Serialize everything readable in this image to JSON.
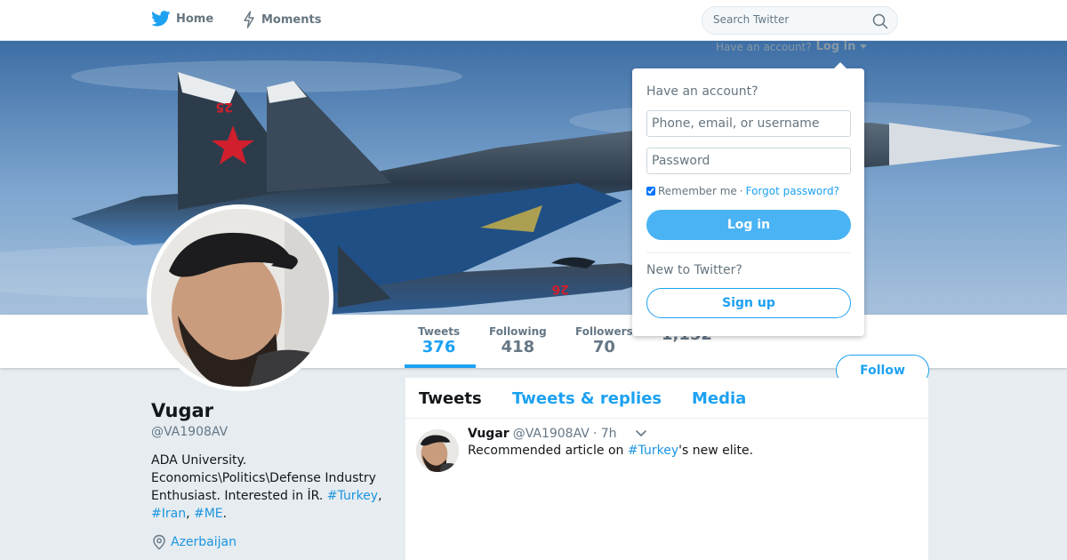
{
  "nav": {
    "home_label": "Home",
    "moments_label": "Moments",
    "search_placeholder": "Search Twitter"
  },
  "account_prompt": {
    "text": "Have an account?",
    "login_label": "Log in"
  },
  "login_dropdown": {
    "heading": "Have an account?",
    "username_placeholder": "Phone, email, or username",
    "password_placeholder": "Password",
    "remember_label": "Remember me",
    "separator": "·",
    "forgot_label": "Forgot password?",
    "login_button": "Log in",
    "new_prompt": "New to Twitter?",
    "signup_button": "Sign up"
  },
  "stats": [
    {
      "label": "Tweets",
      "value": "376"
    },
    {
      "label": "Following",
      "value": "418"
    },
    {
      "label": "Followers",
      "value": "70"
    },
    {
      "label": "",
      "value": "1,152"
    }
  ],
  "follow_button": "Follow",
  "profile": {
    "name": "Vugar",
    "handle": "@VA1908AV",
    "bio_line1": "ADA University.",
    "bio_line2": "Economics\\Politics\\Defense Industry",
    "bio_line3_text": "Enthusiast. Interested in İR. ",
    "bio_tag1": "#Turkey",
    "bio_comma1": ",",
    "bio_tag2": "#Iran",
    "bio_comma2": ", ",
    "bio_tag3": "#ME",
    "bio_period": ".",
    "location": "Azerbaijan"
  },
  "timeline_tabs": [
    {
      "label": "Tweets"
    },
    {
      "label": "Tweets & replies"
    },
    {
      "label": "Media"
    }
  ],
  "tweet": {
    "name": "Vugar",
    "handle": "@VA1908AV",
    "time": "· 7h",
    "text_before": "Recommended article on ",
    "tag": "#Turkey",
    "text_after": "'s new elite."
  },
  "colors": {
    "accent": "#1da1f2",
    "link": "#1b95e0",
    "background": "#e6ecf0"
  }
}
